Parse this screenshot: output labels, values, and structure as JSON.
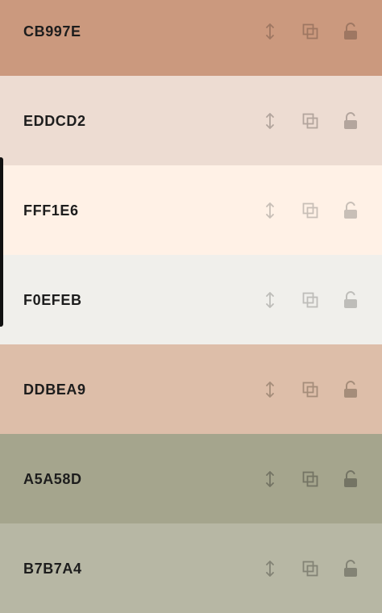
{
  "palette": {
    "colors": [
      {
        "hex": "CB997E",
        "bg": "#CB997E",
        "icon": "#9a7460",
        "iconOpacity": 0.9
      },
      {
        "hex": "EDDCD2",
        "bg": "#EDDCD2",
        "icon": "#9b8f88",
        "iconOpacity": 0.7
      },
      {
        "hex": "FFF1E6",
        "bg": "#FFF1E6",
        "icon": "#a59e98",
        "iconOpacity": 0.6
      },
      {
        "hex": "F0EFEB",
        "bg": "#F0EFEB",
        "icon": "#9d9c99",
        "iconOpacity": 0.6
      },
      {
        "hex": "DDBEA9",
        "bg": "#DDBEA9",
        "icon": "#98826f",
        "iconOpacity": 0.8
      },
      {
        "hex": "A5A58D",
        "bg": "#A5A58D",
        "icon": "#6f6f60",
        "iconOpacity": 0.9
      },
      {
        "hex": "B7B7A4",
        "bg": "#B7B7A4",
        "icon": "#7e7e71",
        "iconOpacity": 0.9
      }
    ],
    "icons": [
      "drag-handle",
      "copy",
      "unlock"
    ]
  }
}
